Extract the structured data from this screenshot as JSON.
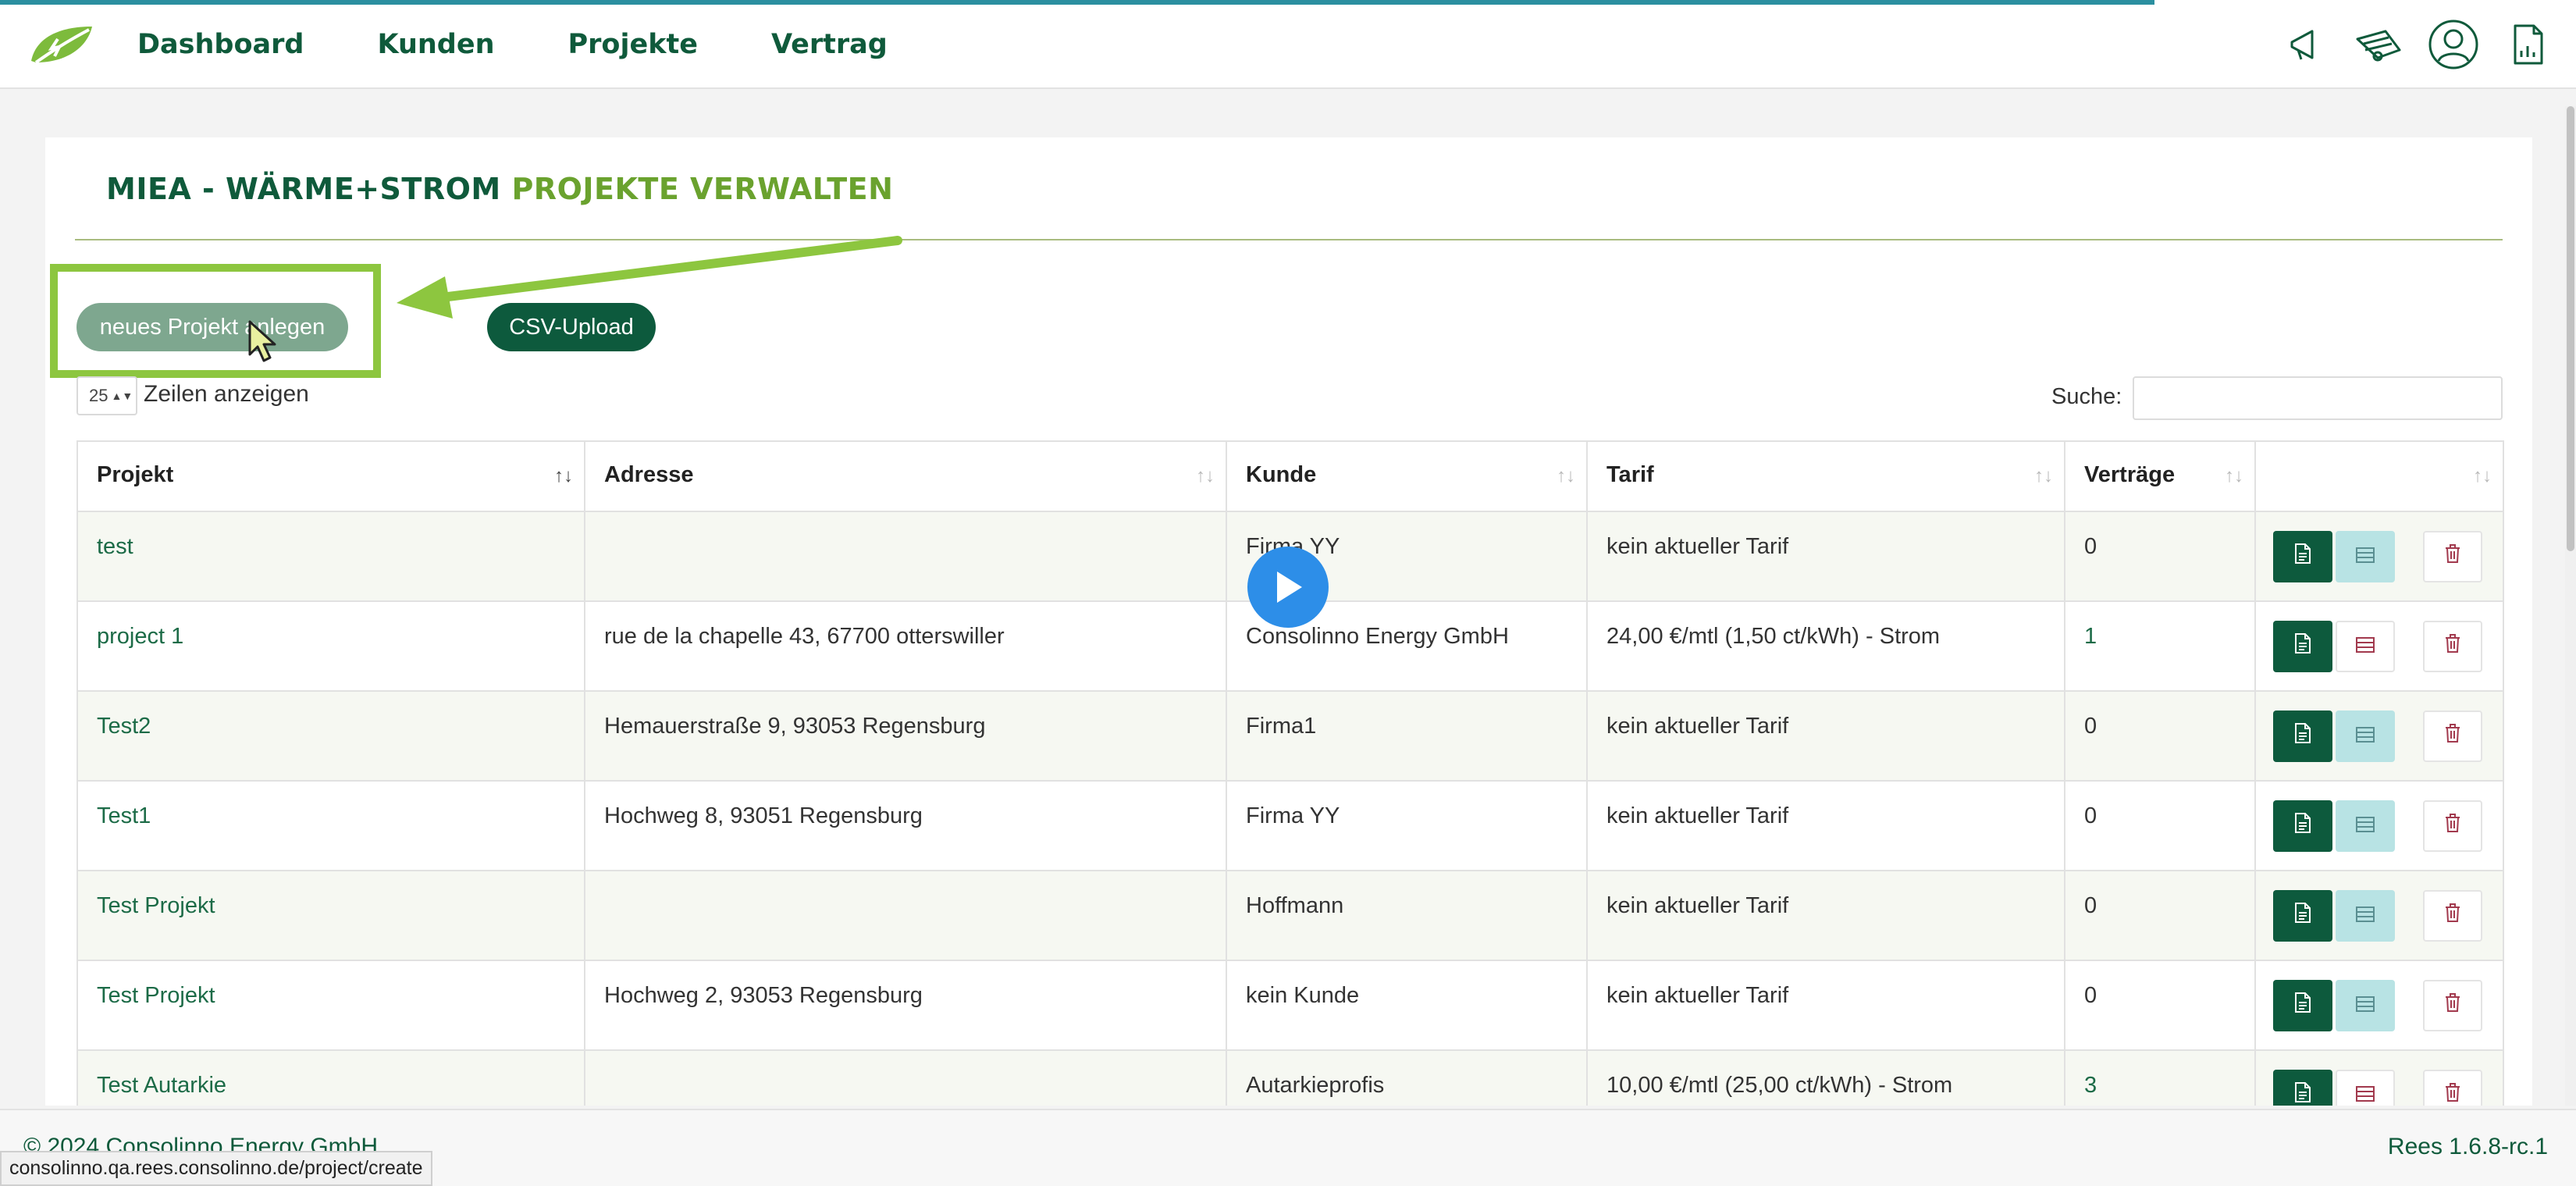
{
  "nav": {
    "items": [
      "Dashboard",
      "Kunden",
      "Projekte",
      "Vertrag"
    ],
    "icons": [
      "megaphone-icon",
      "tractor-icon",
      "user-circle-icon",
      "document-icon"
    ]
  },
  "page": {
    "title_part1": "MIEA - WÄRME+STROM",
    "title_part2": "PROJEKTE VERWALTEN"
  },
  "toolbar": {
    "new_label": "neues Projekt anlegen",
    "csv_label": "CSV-Upload",
    "page_length_value": "25",
    "page_length_label": "Zeilen anzeigen",
    "search_label": "Suche:",
    "search_value": ""
  },
  "table": {
    "headers": [
      "Projekt",
      "Adresse",
      "Kunde",
      "Tarif",
      "Verträge",
      ""
    ],
    "rows": [
      {
        "project": "test",
        "address": "",
        "customer": "Firma YY",
        "tariff": "kein aktueller Tarif",
        "contracts": "0"
      },
      {
        "project": "project 1",
        "address": "rue de la chapelle 43, 67700 otterswiller",
        "customer": "Consolinno Energy GmbH",
        "tariff": "24,00 €/mtl (1,50 ct/kWh) - Strom",
        "contracts": "1"
      },
      {
        "project": "Test2",
        "address": "Hemauerstraße 9, 93053 Regensburg",
        "customer": "Firma1",
        "tariff": "kein aktueller Tarif",
        "contracts": "0"
      },
      {
        "project": "Test1",
        "address": "Hochweg 8, 93051 Regensburg",
        "customer": "Firma YY",
        "tariff": "kein aktueller Tarif",
        "contracts": "0"
      },
      {
        "project": "Test Projekt",
        "address": "",
        "customer": "Hoffmann",
        "tariff": "kein aktueller Tarif",
        "contracts": "0"
      },
      {
        "project": "Test Projekt",
        "address": "Hochweg 2, 93053 Regensburg",
        "customer": "kein Kunde",
        "tariff": "kein aktueller Tarif",
        "contracts": "0"
      },
      {
        "project": "Test Autarkie",
        "address": "",
        "customer": "Autarkieprofis",
        "tariff": "10,00 €/mtl (25,00 ct/kWh) - Strom",
        "contracts": "3"
      }
    ]
  },
  "footer": {
    "copyright": "© 2024 Consolinno Energy GmbH",
    "version": "Rees 1.6.8-rc.1",
    "status_url": "consolinno.qa.rees.consolinno.de/project/create"
  },
  "colors": {
    "brand_dark": "#0f5a3b",
    "brand_light": "#6aa22e",
    "highlight": "#8dc63f",
    "play": "#2d8ee8"
  }
}
